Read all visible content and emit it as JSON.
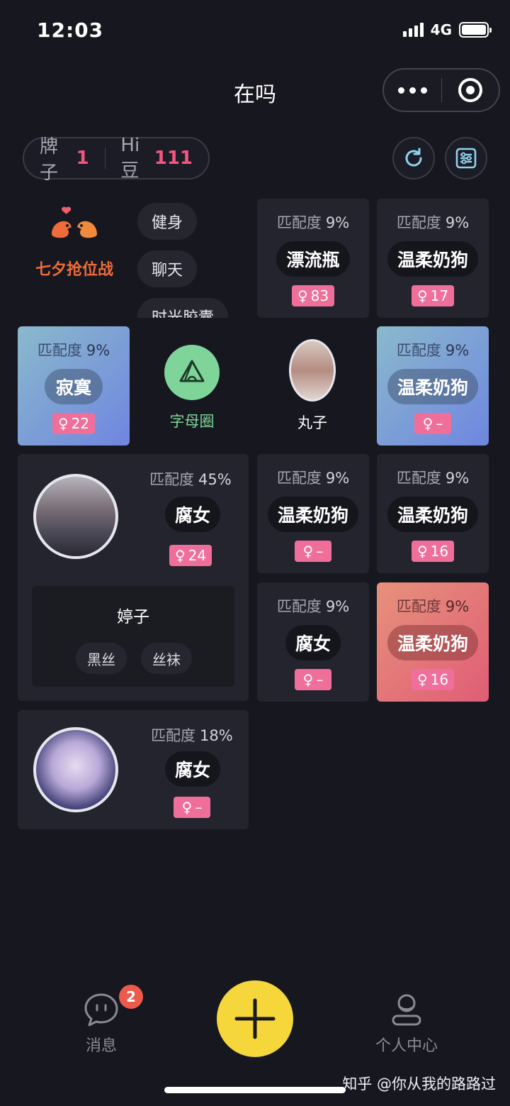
{
  "status_bar": {
    "time": "12:03",
    "network": "4G"
  },
  "header": {
    "title": "在吗"
  },
  "stats": {
    "brand_label": "牌子",
    "brand_count": "1",
    "beans_label": "Hi豆",
    "beans_count": "111"
  },
  "festival": {
    "title": "七夕抢位战"
  },
  "topics": [
    "健身",
    "聊天",
    "时光胶囊"
  ],
  "tiles": [
    {
      "match_label": "匹配度",
      "match": "9%",
      "tag": "漂流瓶",
      "gender": "♀",
      "count": "83"
    },
    {
      "match_label": "匹配度",
      "match": "9%",
      "tag": "温柔奶狗",
      "gender": "♀",
      "count": "17"
    },
    {
      "match_label": "匹配度",
      "match": "9%",
      "tag": "寂寞",
      "gender": "♀",
      "count": "22"
    },
    {
      "match_label": "匹配度",
      "match": "9%",
      "tag": "温柔奶狗",
      "gender": "♀",
      "count": "–"
    },
    {
      "match_label": "匹配度",
      "match": "9%",
      "tag": "温柔奶狗",
      "gender": "♀",
      "count": "–"
    },
    {
      "match_label": "匹配度",
      "match": "9%",
      "tag": "温柔奶狗",
      "gender": "♀",
      "count": "16"
    },
    {
      "match_label": "匹配度",
      "match": "9%",
      "tag": "腐女",
      "gender": "♀",
      "count": "–"
    },
    {
      "match_label": "匹配度",
      "match": "9%",
      "tag": "温柔奶狗",
      "gender": "♀",
      "count": "16"
    }
  ],
  "circle": {
    "label": "字母圈"
  },
  "user_wanzi": {
    "name": "丸子"
  },
  "user_tingzi": {
    "match_label": "匹配度",
    "match": "45%",
    "tag": "腐女",
    "gender": "♀",
    "count": "24",
    "name": "婷子",
    "interests": [
      "黑丝",
      "丝袜"
    ]
  },
  "user_moon": {
    "match_label": "匹配度",
    "match": "18%",
    "tag": "腐女",
    "gender": "♀",
    "count": "–"
  },
  "nav": {
    "messages": "消息",
    "messages_badge": "2",
    "profile": "个人中心"
  },
  "watermark": "知乎 @你从我的路路过",
  "colors": {
    "accent_pink": "#f06f9a",
    "fab_yellow": "#f5d63b",
    "festival_orange": "#ee6b3a",
    "circle_green": "#7fd49a"
  }
}
